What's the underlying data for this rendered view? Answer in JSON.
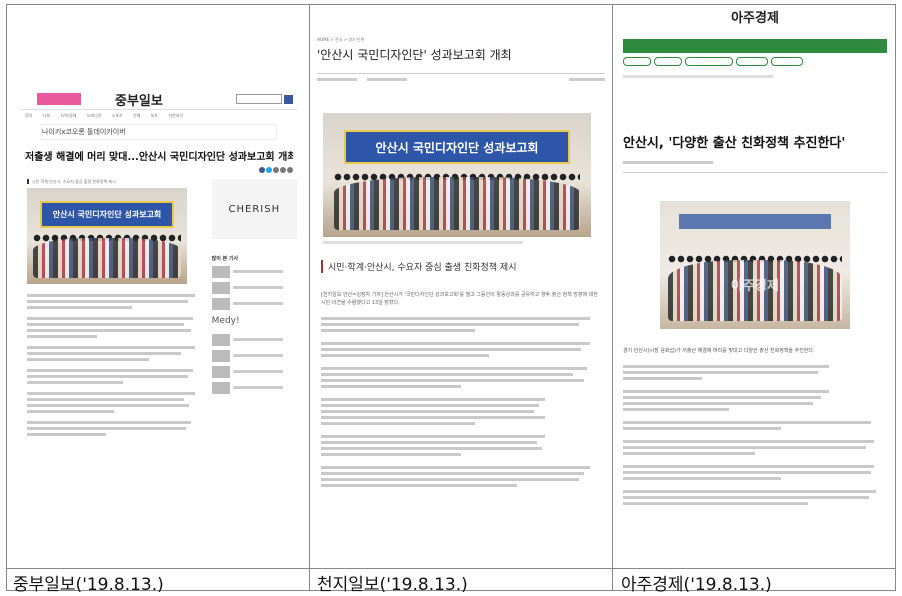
{
  "captions": [
    "중부일보('19.8.13.)",
    "천지일보('19.8.13.)",
    "아주경제('19.8.13.)"
  ],
  "jungbu": {
    "masthead": "중부일보",
    "nav": [
      "정치",
      "사회",
      "지역/경제",
      "오피니언",
      "스포츠",
      "연예",
      "포토",
      "지면보기"
    ],
    "ad_text": "나이키x코오롱 툴데이카이버",
    "headline": "저출생 해결에 머리 맞대...안산시 국민디자인단 성과보고회 개최",
    "subhead": "시민·학계·안산시, 수요자 중심 출생 친화정책 제시",
    "photo_banner": "안산시 국민디자인단 성과보고회",
    "side_ad": "CHERISH",
    "side_title": "많이 본 기사",
    "side_ad2": "Medy!"
  },
  "cheonji": {
    "breadcrumb": "HOME > 전국 > 경기·인천",
    "headline": "'안산시 국민디자인단' 성과보고회 개최",
    "photo_banner": "안산시 국민디자인단 성과보고회",
    "subhead": "시민·학계·안산시, 수요자 중심 출생 친화정책 제시",
    "paragraph": "[천지일보 안산=김정자 기자] 안산시가 '국민디자인단 성과보고회'를 열고 그동안의 활동성과를 공유하고 향후 출산 정책 방향에 대한 시민 의견을 수렴했다고 13일 밝혔다."
  },
  "aju": {
    "masthead": "아주경제",
    "headline": "안산시, '다양한 출산 친화정책 추진한다'",
    "lead": "경기 안산시(시장 윤화섭)가 저출산 해결에 머리를 맞대고 다양한 출산 친화정책을 추진한다.",
    "photo_watermark": "아주경제"
  }
}
